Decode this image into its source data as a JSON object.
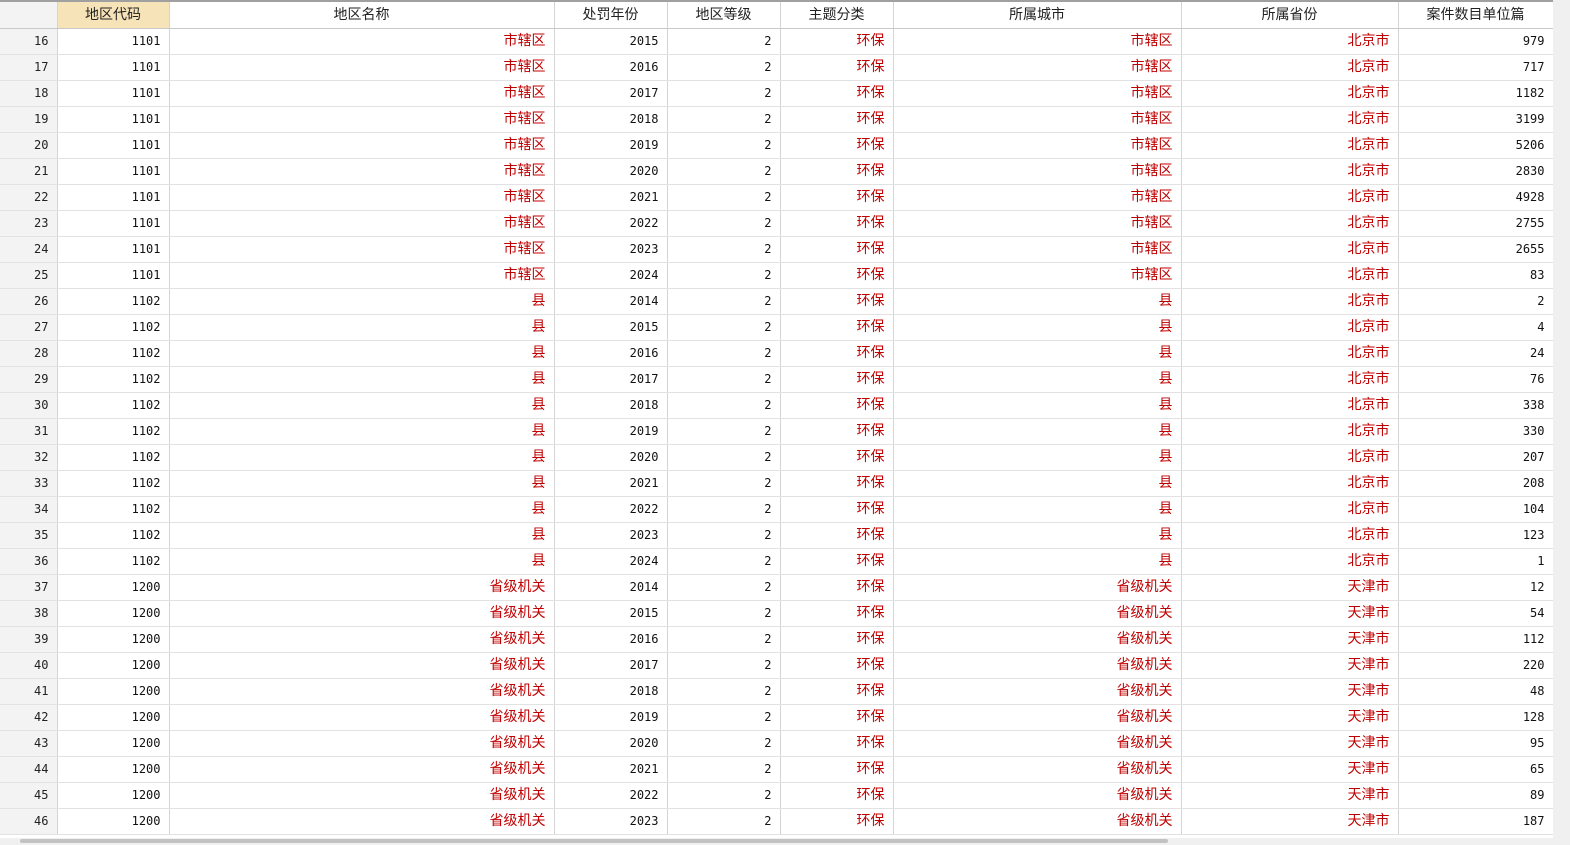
{
  "columns": [
    "地区代码",
    "地区名称",
    "处罚年份",
    "地区等级",
    "主题分类",
    "所属城市",
    "所属省份",
    "案件数目单位篇"
  ],
  "rows": [
    {
      "n": "16",
      "code": "1101",
      "name": "市辖区",
      "year": "2015",
      "level": "2",
      "topic": "环保",
      "city": "市辖区",
      "province": "北京市",
      "count": "979"
    },
    {
      "n": "17",
      "code": "1101",
      "name": "市辖区",
      "year": "2016",
      "level": "2",
      "topic": "环保",
      "city": "市辖区",
      "province": "北京市",
      "count": "717"
    },
    {
      "n": "18",
      "code": "1101",
      "name": "市辖区",
      "year": "2017",
      "level": "2",
      "topic": "环保",
      "city": "市辖区",
      "province": "北京市",
      "count": "1182"
    },
    {
      "n": "19",
      "code": "1101",
      "name": "市辖区",
      "year": "2018",
      "level": "2",
      "topic": "环保",
      "city": "市辖区",
      "province": "北京市",
      "count": "3199"
    },
    {
      "n": "20",
      "code": "1101",
      "name": "市辖区",
      "year": "2019",
      "level": "2",
      "topic": "环保",
      "city": "市辖区",
      "province": "北京市",
      "count": "5206"
    },
    {
      "n": "21",
      "code": "1101",
      "name": "市辖区",
      "year": "2020",
      "level": "2",
      "topic": "环保",
      "city": "市辖区",
      "province": "北京市",
      "count": "2830"
    },
    {
      "n": "22",
      "code": "1101",
      "name": "市辖区",
      "year": "2021",
      "level": "2",
      "topic": "环保",
      "city": "市辖区",
      "province": "北京市",
      "count": "4928"
    },
    {
      "n": "23",
      "code": "1101",
      "name": "市辖区",
      "year": "2022",
      "level": "2",
      "topic": "环保",
      "city": "市辖区",
      "province": "北京市",
      "count": "2755"
    },
    {
      "n": "24",
      "code": "1101",
      "name": "市辖区",
      "year": "2023",
      "level": "2",
      "topic": "环保",
      "city": "市辖区",
      "province": "北京市",
      "count": "2655"
    },
    {
      "n": "25",
      "code": "1101",
      "name": "市辖区",
      "year": "2024",
      "level": "2",
      "topic": "环保",
      "city": "市辖区",
      "province": "北京市",
      "count": "83"
    },
    {
      "n": "26",
      "code": "1102",
      "name": "县",
      "year": "2014",
      "level": "2",
      "topic": "环保",
      "city": "县",
      "province": "北京市",
      "count": "2"
    },
    {
      "n": "27",
      "code": "1102",
      "name": "县",
      "year": "2015",
      "level": "2",
      "topic": "环保",
      "city": "县",
      "province": "北京市",
      "count": "4"
    },
    {
      "n": "28",
      "code": "1102",
      "name": "县",
      "year": "2016",
      "level": "2",
      "topic": "环保",
      "city": "县",
      "province": "北京市",
      "count": "24"
    },
    {
      "n": "29",
      "code": "1102",
      "name": "县",
      "year": "2017",
      "level": "2",
      "topic": "环保",
      "city": "县",
      "province": "北京市",
      "count": "76"
    },
    {
      "n": "30",
      "code": "1102",
      "name": "县",
      "year": "2018",
      "level": "2",
      "topic": "环保",
      "city": "县",
      "province": "北京市",
      "count": "338"
    },
    {
      "n": "31",
      "code": "1102",
      "name": "县",
      "year": "2019",
      "level": "2",
      "topic": "环保",
      "city": "县",
      "province": "北京市",
      "count": "330"
    },
    {
      "n": "32",
      "code": "1102",
      "name": "县",
      "year": "2020",
      "level": "2",
      "topic": "环保",
      "city": "县",
      "province": "北京市",
      "count": "207"
    },
    {
      "n": "33",
      "code": "1102",
      "name": "县",
      "year": "2021",
      "level": "2",
      "topic": "环保",
      "city": "县",
      "province": "北京市",
      "count": "208"
    },
    {
      "n": "34",
      "code": "1102",
      "name": "县",
      "year": "2022",
      "level": "2",
      "topic": "环保",
      "city": "县",
      "province": "北京市",
      "count": "104"
    },
    {
      "n": "35",
      "code": "1102",
      "name": "县",
      "year": "2023",
      "level": "2",
      "topic": "环保",
      "city": "县",
      "province": "北京市",
      "count": "123"
    },
    {
      "n": "36",
      "code": "1102",
      "name": "县",
      "year": "2024",
      "level": "2",
      "topic": "环保",
      "city": "县",
      "province": "北京市",
      "count": "1"
    },
    {
      "n": "37",
      "code": "1200",
      "name": "省级机关",
      "year": "2014",
      "level": "2",
      "topic": "环保",
      "city": "省级机关",
      "province": "天津市",
      "count": "12"
    },
    {
      "n": "38",
      "code": "1200",
      "name": "省级机关",
      "year": "2015",
      "level": "2",
      "topic": "环保",
      "city": "省级机关",
      "province": "天津市",
      "count": "54"
    },
    {
      "n": "39",
      "code": "1200",
      "name": "省级机关",
      "year": "2016",
      "level": "2",
      "topic": "环保",
      "city": "省级机关",
      "province": "天津市",
      "count": "112"
    },
    {
      "n": "40",
      "code": "1200",
      "name": "省级机关",
      "year": "2017",
      "level": "2",
      "topic": "环保",
      "city": "省级机关",
      "province": "天津市",
      "count": "220"
    },
    {
      "n": "41",
      "code": "1200",
      "name": "省级机关",
      "year": "2018",
      "level": "2",
      "topic": "环保",
      "city": "省级机关",
      "province": "天津市",
      "count": "48"
    },
    {
      "n": "42",
      "code": "1200",
      "name": "省级机关",
      "year": "2019",
      "level": "2",
      "topic": "环保",
      "city": "省级机关",
      "province": "天津市",
      "count": "128"
    },
    {
      "n": "43",
      "code": "1200",
      "name": "省级机关",
      "year": "2020",
      "level": "2",
      "topic": "环保",
      "city": "省级机关",
      "province": "天津市",
      "count": "95"
    },
    {
      "n": "44",
      "code": "1200",
      "name": "省级机关",
      "year": "2021",
      "level": "2",
      "topic": "环保",
      "city": "省级机关",
      "province": "天津市",
      "count": "65"
    },
    {
      "n": "45",
      "code": "1200",
      "name": "省级机关",
      "year": "2022",
      "level": "2",
      "topic": "环保",
      "city": "省级机关",
      "province": "天津市",
      "count": "89"
    },
    {
      "n": "46",
      "code": "1200",
      "name": "省级机关",
      "year": "2023",
      "level": "2",
      "topic": "环保",
      "city": "省级机关",
      "province": "天津市",
      "count": "187"
    }
  ]
}
